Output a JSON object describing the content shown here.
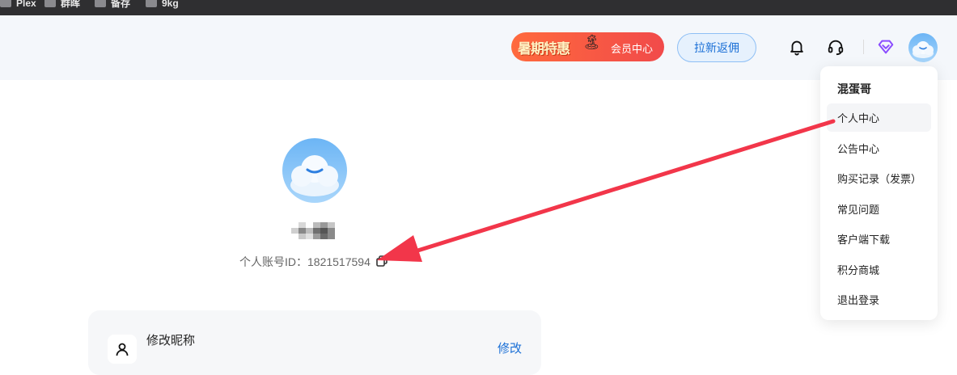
{
  "bookmarks": [
    {
      "label": "Plex",
      "icon": "folder-icon"
    },
    {
      "label": "群晖",
      "icon": "folder-icon"
    },
    {
      "label": "备存",
      "icon": "folder-icon"
    },
    {
      "label": "9kg",
      "icon": "folder-icon"
    }
  ],
  "header": {
    "promo_badge": "暑期特惠",
    "promo_label": "会员中心",
    "invite_label": "拉新返佣",
    "icons": [
      "bell-icon",
      "headset-icon",
      "diamond-icon"
    ]
  },
  "profile": {
    "account_id_label": "个人账号ID：1821517594"
  },
  "card": {
    "title": "修改昵称",
    "action": "修改"
  },
  "dropdown": {
    "username": "混蛋哥",
    "items": [
      {
        "label": "个人中心",
        "active": true
      },
      {
        "label": "公告中心"
      },
      {
        "label": "购买记录（发票）"
      },
      {
        "label": "常见问题"
      },
      {
        "label": "客户端下载"
      },
      {
        "label": "积分商城"
      },
      {
        "label": "退出登录"
      }
    ]
  },
  "colors": {
    "accent": "#1a6fd6",
    "promo": "#f14a4a",
    "arrow": "#f2364a",
    "diamond": "#8b4dff"
  }
}
